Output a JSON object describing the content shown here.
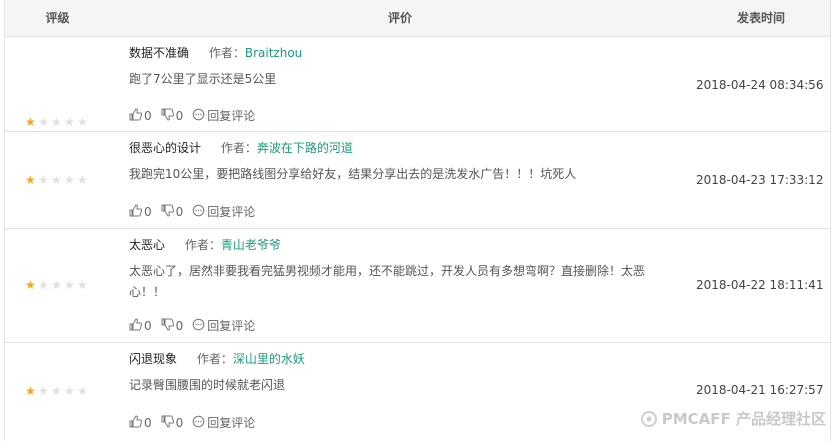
{
  "header": {
    "rating": "评级",
    "review": "评价",
    "time": "发表时间"
  },
  "author_label": "作者：",
  "colors": {
    "star_on": "#f5a623",
    "star_off": "#e0e0e0",
    "author": "#1a9c7a"
  },
  "reviews": [
    {
      "title": "数据不准确",
      "author": "Braitzhou",
      "content": "跑了7公里了显示还是5公里",
      "stars": 1,
      "likes": "0",
      "dislikes": "0",
      "reply": "回复评论",
      "time": "2018-04-24 08:34:56"
    },
    {
      "title": "很恶心的设计",
      "author": "奔波在下路的河道",
      "content": "我跑完10公里，要把路线图分享给好友，结果分享出去的是洗发水广告！！！坑死人",
      "stars": 1,
      "likes": "0",
      "dislikes": "0",
      "reply": "回复评论",
      "time": "2018-04-23 17:33:12"
    },
    {
      "title": "太恶心",
      "author": "青山老爷爷",
      "content": "太恶心了，居然非要我看完猛男视频才能用，还不能跳过，开发人员有多想弯啊？直接删除！太恶心！！",
      "stars": 1,
      "likes": "0",
      "dislikes": "0",
      "reply": "回复评论",
      "time": "2018-04-22 18:11:41"
    },
    {
      "title": "闪退现象",
      "author": "深山里的水妖",
      "content": "记录臀围腰围的时候就老闪退",
      "stars": 1,
      "likes": "0",
      "dislikes": "0",
      "reply": "回复评论",
      "time": "2018-04-21 16:27:57"
    }
  ],
  "watermark": "PMCAFF 产品经理社区"
}
